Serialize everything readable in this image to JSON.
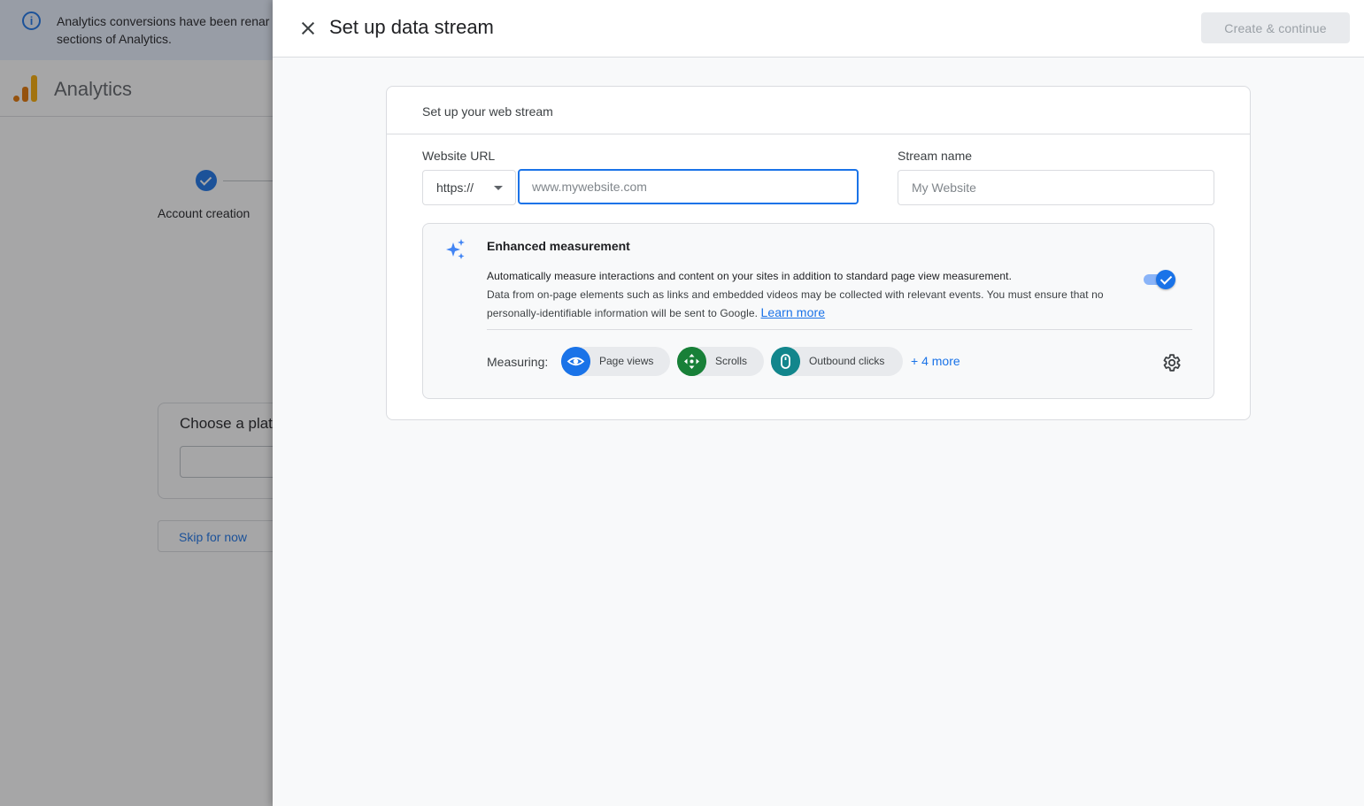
{
  "background": {
    "banner_text": "Analytics conversions have been renamed ... sections of Analytics.",
    "banner_line1": "Analytics conversions have been renar",
    "banner_line2": "sections of Analytics.",
    "app_title": "Analytics",
    "step_label": "Account creation",
    "card_title": "Choose a platf",
    "skip_label": "Skip for now"
  },
  "drawer": {
    "title": "Set up data stream",
    "create_button": "Create & continue"
  },
  "stream_card": {
    "title": "Set up your web stream",
    "url_label": "Website URL",
    "protocol_value": "https://",
    "url_placeholder": "www.mywebsite.com",
    "url_value": "",
    "name_label": "Stream name",
    "name_placeholder": "My Website",
    "name_value": ""
  },
  "enhanced_measurement": {
    "title": "Enhanced measurement",
    "description_bold": "Automatically measure interactions and content on your sites in addition to standard page view measurement.",
    "description": "Data from on-page elements such as links and embedded videos may be collected with relevant events. You must ensure that no personally-identifiable information will be sent to Google.",
    "learn_more": "Learn more",
    "enabled": true,
    "measuring_label": "Measuring:",
    "chips": [
      {
        "label": "Page views",
        "icon": "eye-icon",
        "color": "#1a73e8"
      },
      {
        "label": "Scrolls",
        "icon": "scroll-arrows-icon",
        "color": "#188038"
      },
      {
        "label": "Outbound clicks",
        "icon": "mouse-icon",
        "color": "#12868c"
      }
    ],
    "more_link": "+ 4 more"
  },
  "colors": {
    "accent": "#1a73e8",
    "analytics_orange": "#e37400",
    "analytics_yellow": "#f9ab00"
  }
}
